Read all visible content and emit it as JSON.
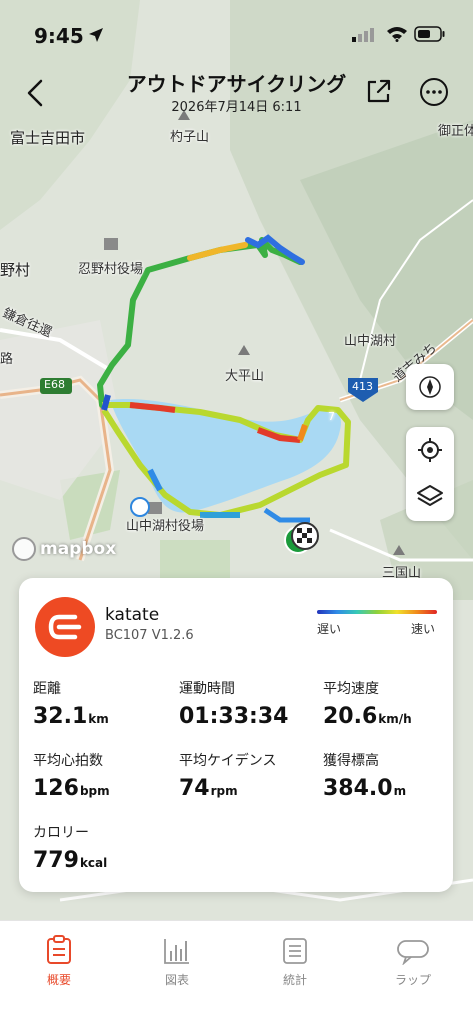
{
  "status_bar": {
    "time": "9:45"
  },
  "header": {
    "title": "アウトドアサイクリング",
    "subtitle": "2026年7月14日 6:11"
  },
  "map": {
    "labels": {
      "fujiyoshida": "富士吉田市",
      "murako": "杓子山",
      "oshino_office": "忍野村役場",
      "oshino_village": "野村",
      "yamanakako_village": "山中湖村",
      "ohirayama": "大平山",
      "e68": "E68",
      "road413": "413",
      "yamanaka_office": "山中湖村役場",
      "kamakura": "鎌倉往還",
      "michi": "道志みち",
      "sankoku": "三国山",
      "misakayama": "御正体",
      "ro": "路",
      "route_small": "7"
    },
    "attribution": "mapbox"
  },
  "device": {
    "name": "katate",
    "model": "BC107  V1.2.6"
  },
  "legend": {
    "slow": "遅い",
    "fast": "速い"
  },
  "stats": {
    "distance": {
      "label": "距離",
      "value": "32.1",
      "unit": "km"
    },
    "moving_time": {
      "label": "運動時間",
      "value": "01:33:34",
      "unit": ""
    },
    "avg_speed": {
      "label": "平均速度",
      "value": "20.6",
      "unit": "km/h"
    },
    "avg_hr": {
      "label": "平均心拍数",
      "value": "126",
      "unit": "bpm"
    },
    "avg_cadence": {
      "label": "平均ケイデンス",
      "value": "74",
      "unit": "rpm"
    },
    "elevation_gain": {
      "label": "獲得標高",
      "value": "384.0",
      "unit": "m"
    },
    "calories": {
      "label": "カロリー",
      "value": "779",
      "unit": "kcal"
    }
  },
  "tabs": [
    {
      "label": "概要",
      "active": true
    },
    {
      "label": "図表",
      "active": false
    },
    {
      "label": "統計",
      "active": false
    },
    {
      "label": "ラップ",
      "active": false
    }
  ],
  "colors": {
    "accent": "#e8492a",
    "lake": "#a9d9f3",
    "map_land": "#d9dfd3"
  }
}
